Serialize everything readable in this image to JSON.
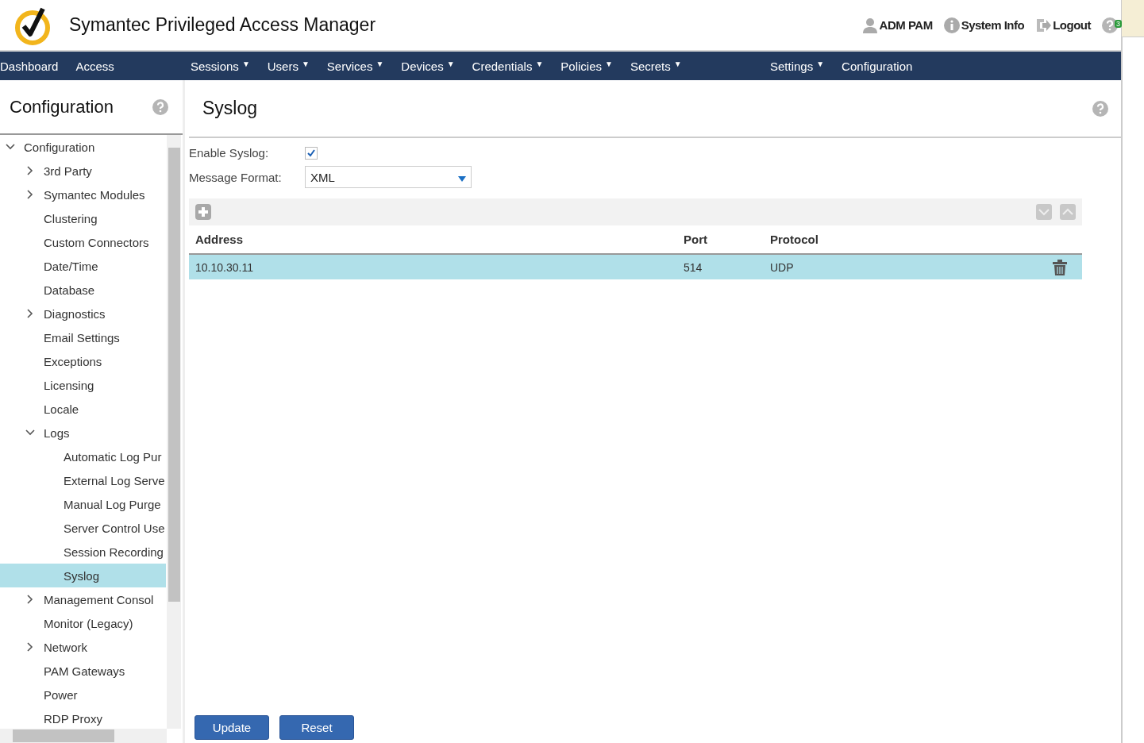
{
  "header": {
    "title": "Symantec Privileged Access Manager",
    "user": "ADM PAM",
    "system_info": "System Info",
    "logout": "Logout",
    "badge": "3"
  },
  "nav": {
    "groups": [
      [
        {
          "label": "Dashboard"
        },
        {
          "label": "Access"
        }
      ],
      [
        {
          "label": "Sessions",
          "caret": "▼"
        },
        {
          "label": "Users",
          "caret": "▼"
        },
        {
          "label": "Services",
          "caret": "▼"
        },
        {
          "label": "Devices",
          "caret": "▼"
        },
        {
          "label": "Credentials",
          "caret": "▼"
        },
        {
          "label": "Policies",
          "caret": "▼"
        },
        {
          "label": "Secrets",
          "caret": "▼"
        }
      ],
      [
        {
          "label": "Settings",
          "caret": "▼"
        },
        {
          "label": "Configuration"
        }
      ]
    ]
  },
  "sidebar": {
    "title": "Configuration",
    "tree": [
      {
        "label": "Configuration",
        "expanded": true,
        "selected": false,
        "children": [
          {
            "label": "3rd Party",
            "expanded": false,
            "selected": false
          },
          {
            "label": "Symantec Modules",
            "expanded": false,
            "selected": false
          },
          {
            "label": "Clustering",
            "selected": false
          },
          {
            "label": "Custom Connectors",
            "selected": false
          },
          {
            "label": "Date/Time",
            "selected": false
          },
          {
            "label": "Database",
            "selected": false
          },
          {
            "label": "Diagnostics",
            "expanded": false,
            "selected": false
          },
          {
            "label": "Email Settings",
            "selected": false
          },
          {
            "label": "Exceptions",
            "selected": false
          },
          {
            "label": "Licensing",
            "selected": false
          },
          {
            "label": "Locale",
            "selected": false
          },
          {
            "label": "Logs",
            "expanded": true,
            "selected": false,
            "children": [
              {
                "label": "Automatic Log Pur",
                "selected": false
              },
              {
                "label": "External Log Serve",
                "selected": false
              },
              {
                "label": "Manual Log Purge",
                "selected": false
              },
              {
                "label": "Server Control Use",
                "selected": false
              },
              {
                "label": "Session Recording",
                "selected": false
              },
              {
                "label": "Syslog",
                "selected": true
              }
            ]
          },
          {
            "label": "Management Consol",
            "expanded": false,
            "selected": false
          },
          {
            "label": "Monitor (Legacy)",
            "selected": false
          },
          {
            "label": "Network",
            "expanded": false,
            "selected": false
          },
          {
            "label": "PAM Gateways",
            "selected": false
          },
          {
            "label": "Power",
            "selected": false
          },
          {
            "label": "RDP Proxy",
            "selected": false
          }
        ]
      }
    ]
  },
  "main": {
    "title": "Syslog",
    "enable_label": "Enable Syslog:",
    "enable_checked": true,
    "format_label": "Message Format:",
    "format_value": "XML",
    "table": {
      "columns": [
        "Address",
        "Port",
        "Protocol"
      ],
      "rows": [
        {
          "cells": [
            "10.10.30.11",
            "514",
            "UDP"
          ],
          "selected": true
        }
      ]
    },
    "buttons": [
      "Update",
      "Reset"
    ]
  }
}
